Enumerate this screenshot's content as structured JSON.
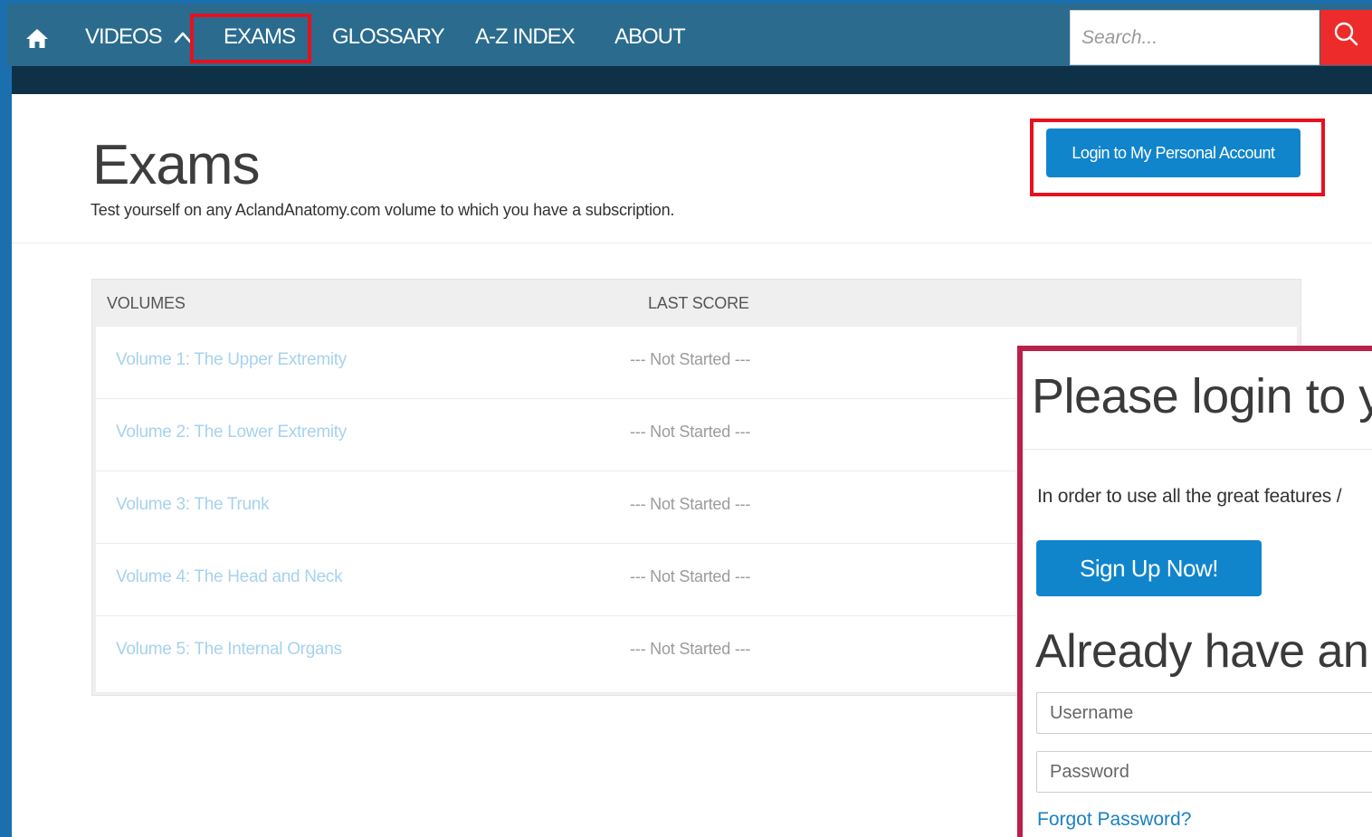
{
  "nav": {
    "items": [
      "VIDEOS",
      "EXAMS",
      "GLOSSARY",
      "A-Z INDEX",
      "ABOUT"
    ],
    "home_icon": "home-icon",
    "videos_icon": "chevron-up-icon",
    "search_placeholder": "Search...",
    "search_icon": "search-icon"
  },
  "header": {
    "title": "Exams",
    "subtitle": "Test yourself on any AclandAnatomy.com volume to which you have a subscription.",
    "login_button": "Login to My Personal Account"
  },
  "table": {
    "columns": [
      "VOLUMES",
      "LAST SCORE"
    ],
    "rows": [
      {
        "volume": "Volume 1: The Upper Extremity",
        "score": "--- Not Started ---"
      },
      {
        "volume": "Volume 2: The Lower Extremity",
        "score": "--- Not Started ---"
      },
      {
        "volume": "Volume 3: The Trunk",
        "score": "--- Not Started ---"
      },
      {
        "volume": "Volume 4: The Head and Neck",
        "score": "--- Not Started ---"
      },
      {
        "volume": "Volume 5: The Internal Organs",
        "score": "--- Not Started ---"
      }
    ]
  },
  "modal": {
    "title": "Please login to y",
    "text": "In order to use all the great features /",
    "signup_button": "Sign Up Now!",
    "title2": "Already have an",
    "username_placeholder": "Username",
    "password_placeholder": "Password",
    "forgot_link": "Forgot Password?"
  },
  "colors": {
    "navbar": "#2a6b8e",
    "nav_strip": "#0e3147",
    "accent_blue": "#1185cc",
    "highlight_red": "#e8101e",
    "modal_border": "#b9204a",
    "search_red": "#ee2b2b"
  }
}
